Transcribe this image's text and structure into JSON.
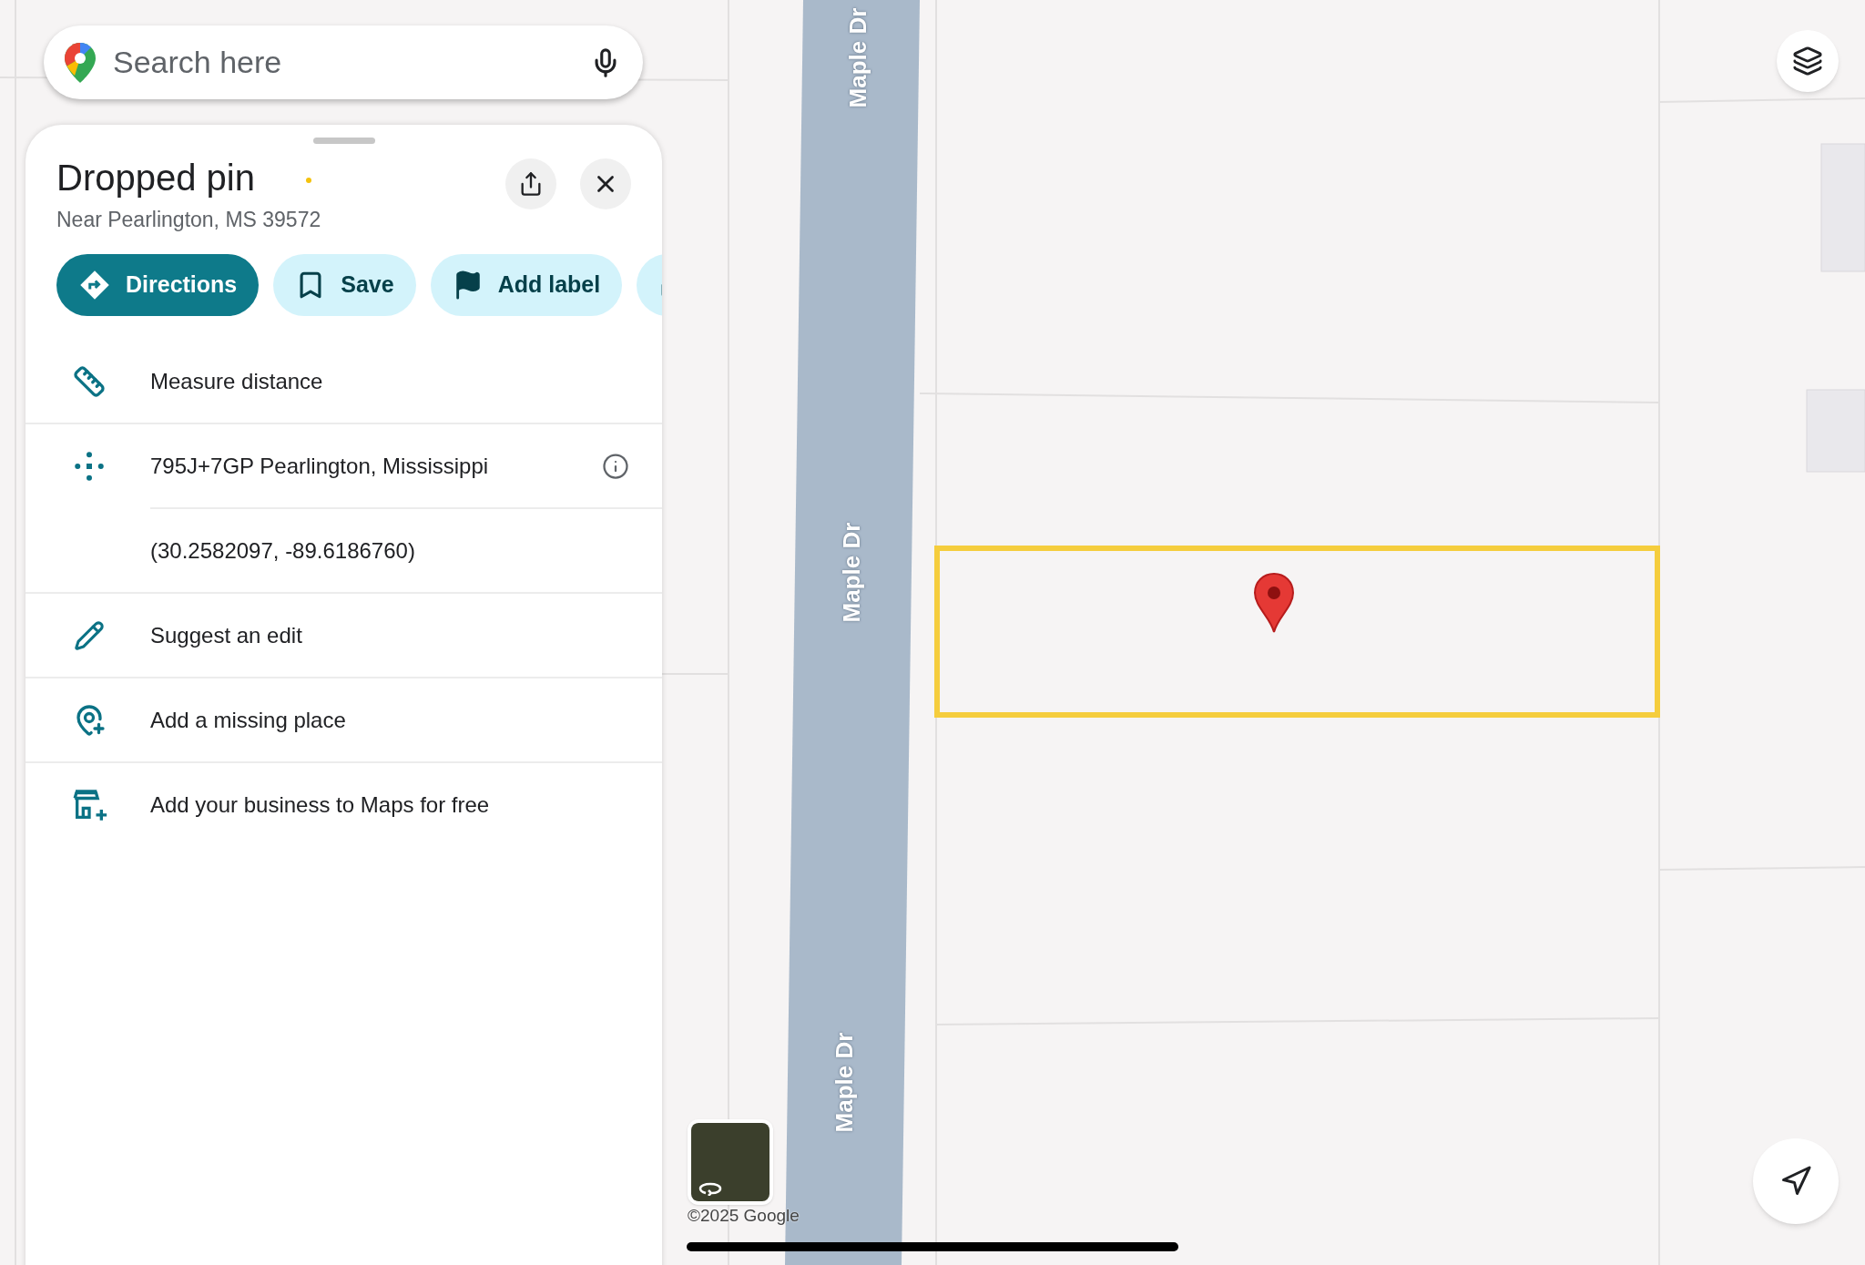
{
  "search": {
    "placeholder": "Search here"
  },
  "place": {
    "title": "Dropped pin",
    "subtitle": "Near Pearlington, MS 39572"
  },
  "actions": [
    {
      "kind": "directions",
      "label": "Directions"
    },
    {
      "kind": "save",
      "label": "Save"
    },
    {
      "kind": "label",
      "label": "Add label"
    },
    {
      "kind": "share"
    }
  ],
  "rows": [
    {
      "kind": "measure",
      "text": "Measure distance"
    },
    {
      "kind": "pluscode",
      "text": "795J+7GP Pearlington, Mississippi"
    },
    {
      "kind": "coords",
      "text": "(30.2582097, -89.6186760)"
    },
    {
      "kind": "edit",
      "text": "Suggest an edit"
    },
    {
      "kind": "place",
      "text": "Add a missing place"
    },
    {
      "kind": "business",
      "text": "Add your business to Maps for free"
    }
  ],
  "map": {
    "road_labels": [
      "Maple Dr",
      "Maple Dr",
      "Maple Dr"
    ],
    "copyright": "©2025 Google"
  }
}
